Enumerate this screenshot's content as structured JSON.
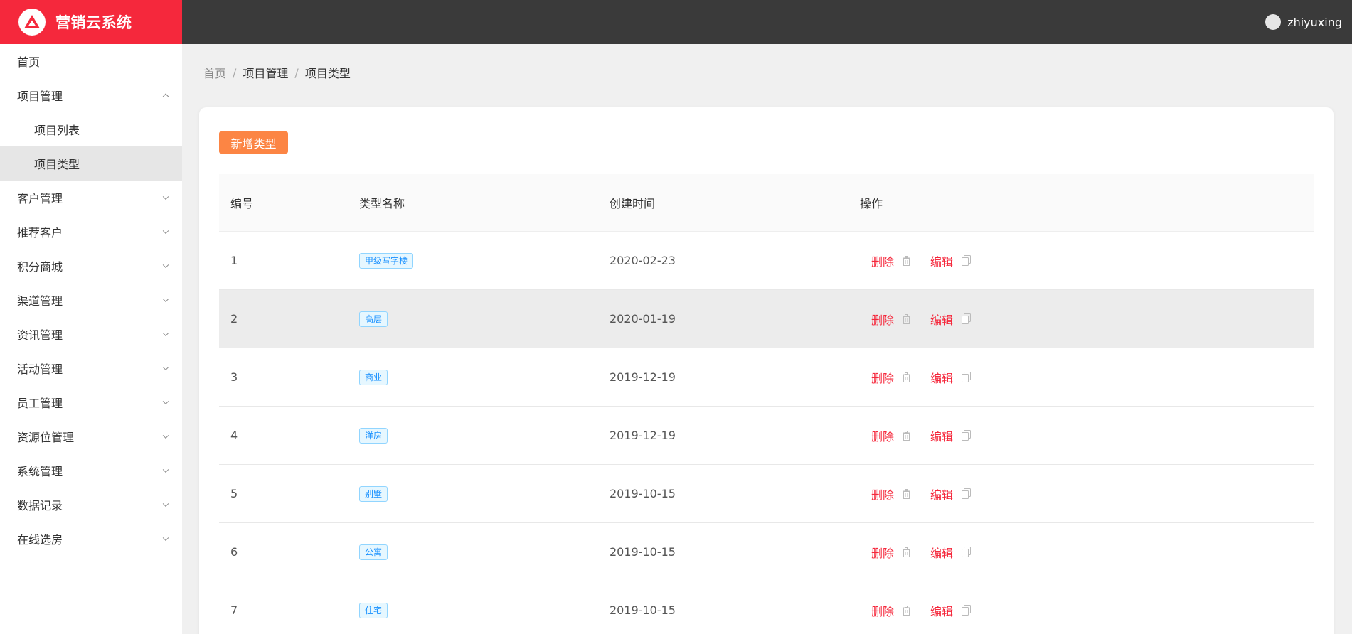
{
  "app": {
    "title": "营销云系统",
    "brand_color": "#f5283c",
    "logo_icon": "triangle-logo-icon"
  },
  "user": {
    "name": "zhiyuxing"
  },
  "sidebar": {
    "items": [
      {
        "label": "首页",
        "expandable": false
      },
      {
        "label": "项目管理",
        "expandable": true,
        "expanded": true,
        "children": [
          {
            "label": "项目列表",
            "active": false
          },
          {
            "label": "项目类型",
            "active": true
          }
        ]
      },
      {
        "label": "客户管理",
        "expandable": true
      },
      {
        "label": "推荐客户",
        "expandable": true
      },
      {
        "label": "积分商城",
        "expandable": true
      },
      {
        "label": "渠道管理",
        "expandable": true
      },
      {
        "label": "资讯管理",
        "expandable": true
      },
      {
        "label": "活动管理",
        "expandable": true
      },
      {
        "label": "员工管理",
        "expandable": true
      },
      {
        "label": "资源位管理",
        "expandable": true
      },
      {
        "label": "系统管理",
        "expandable": true
      },
      {
        "label": "数据记录",
        "expandable": true
      },
      {
        "label": "在线选房",
        "expandable": true
      }
    ]
  },
  "breadcrumb": {
    "home": "首页",
    "separator": "/",
    "level1": "项目管理",
    "level2": "项目类型"
  },
  "toolbar": {
    "add_label": "新增类型",
    "add_color": "#fc8544"
  },
  "table": {
    "headers": [
      "编号",
      "类型名称",
      "创建时间",
      "操作"
    ],
    "delete_label": "删除",
    "edit_label": "编辑",
    "rows": [
      {
        "id": "1",
        "name": "甲级写字楼",
        "date": "2020-02-23"
      },
      {
        "id": "2",
        "name": "高层",
        "date": "2020-01-19"
      },
      {
        "id": "3",
        "name": "商业",
        "date": "2019-12-19"
      },
      {
        "id": "4",
        "name": "洋房",
        "date": "2019-12-19"
      },
      {
        "id": "5",
        "name": "别墅",
        "date": "2019-10-15"
      },
      {
        "id": "6",
        "name": "公寓",
        "date": "2019-10-15"
      },
      {
        "id": "7",
        "name": "住宅",
        "date": "2019-10-15"
      }
    ]
  }
}
